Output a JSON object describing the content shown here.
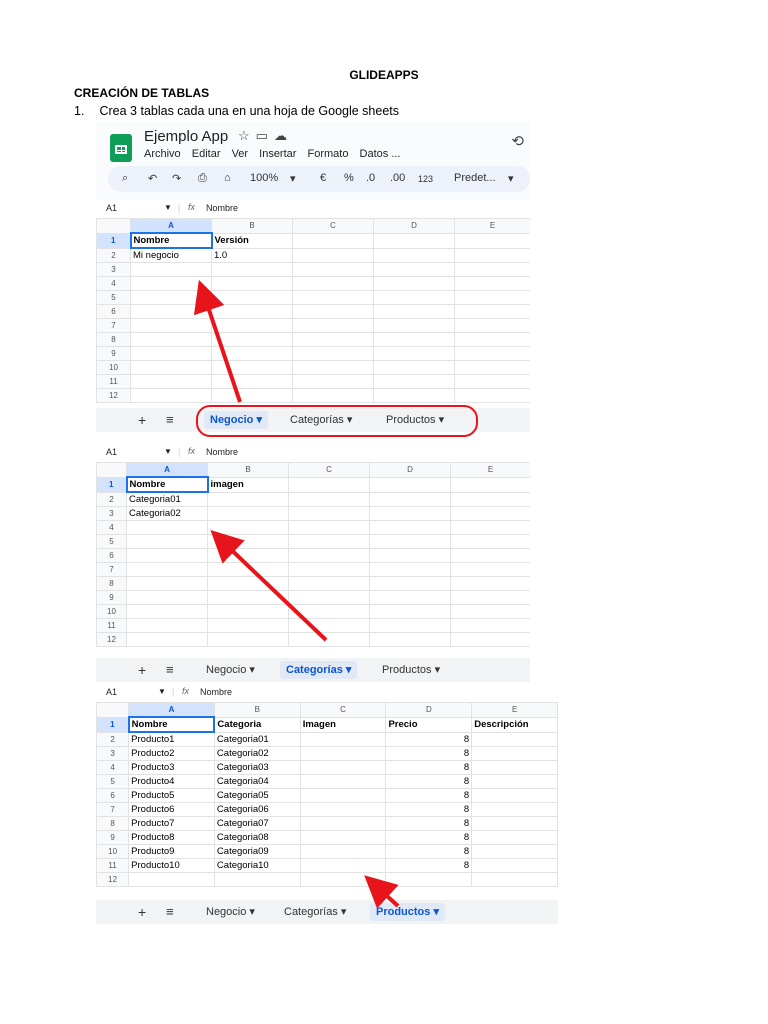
{
  "document": {
    "title": "GLIDEAPPS",
    "section": "CREACIÓN DE TABLAS",
    "step_number": "1.",
    "step_text": "Crea 3 tablas cada una en una hoja de Google sheets"
  },
  "app": {
    "title": "Ejemplo App",
    "menus": [
      "Archivo",
      "Editar",
      "Ver",
      "Insertar",
      "Formato",
      "Datos ..."
    ],
    "zoom": "100%",
    "toolbar_format": [
      "€",
      "%",
      ".0",
      ".00",
      "123"
    ],
    "font": "Predet...",
    "icons": [
      "search-icon",
      "undo-icon",
      "redo-icon",
      "print-icon",
      "paint-format-icon",
      "star-icon",
      "folder-icon",
      "cloud-icon",
      "history-icon"
    ]
  },
  "sheets": [
    {
      "cell_ref": "A1",
      "formula_value": "Nombre",
      "columns": [
        "A",
        "B",
        "C",
        "D",
        "E"
      ],
      "rows": [
        [
          "1",
          "Nombre",
          "Versión",
          "",
          "",
          ""
        ],
        [
          "2",
          "Mi negocio",
          "1.0",
          "",
          "",
          ""
        ],
        [
          "3",
          "",
          "",
          "",
          "",
          ""
        ],
        [
          "4",
          "",
          "",
          "",
          "",
          ""
        ],
        [
          "5",
          "",
          "",
          "",
          "",
          ""
        ],
        [
          "6",
          "",
          "",
          "",
          "",
          ""
        ],
        [
          "7",
          "",
          "",
          "",
          "",
          ""
        ],
        [
          "8",
          "",
          "",
          "",
          "",
          ""
        ],
        [
          "9",
          "",
          "",
          "",
          "",
          ""
        ],
        [
          "10",
          "",
          "",
          "",
          "",
          ""
        ],
        [
          "11",
          "",
          "",
          "",
          "",
          ""
        ],
        [
          "12",
          "",
          "",
          "",
          "",
          ""
        ]
      ],
      "tabs": [
        "Negocio ▾",
        "Categorías ▾",
        "Productos ▾"
      ],
      "active_tab": 0
    },
    {
      "cell_ref": "A1",
      "formula_value": "Nombre",
      "columns": [
        "A",
        "B",
        "C",
        "D",
        "E"
      ],
      "rows": [
        [
          "1",
          "Nombre",
          "imagen",
          "",
          "",
          ""
        ],
        [
          "2",
          "Categoria01",
          "",
          "",
          "",
          ""
        ],
        [
          "3",
          "Categoria02",
          "",
          "",
          "",
          ""
        ],
        [
          "4",
          "",
          "",
          "",
          "",
          ""
        ],
        [
          "5",
          "",
          "",
          "",
          "",
          ""
        ],
        [
          "6",
          "",
          "",
          "",
          "",
          ""
        ],
        [
          "7",
          "",
          "",
          "",
          "",
          ""
        ],
        [
          "8",
          "",
          "",
          "",
          "",
          ""
        ],
        [
          "9",
          "",
          "",
          "",
          "",
          ""
        ],
        [
          "10",
          "",
          "",
          "",
          "",
          ""
        ],
        [
          "11",
          "",
          "",
          "",
          "",
          ""
        ],
        [
          "12",
          "",
          "",
          "",
          "",
          ""
        ]
      ],
      "tabs": [
        "Negocio ▾",
        "Categorías ▾",
        "Productos ▾"
      ],
      "active_tab": 1
    },
    {
      "cell_ref": "A1",
      "formula_value": "Nombre",
      "columns": [
        "A",
        "B",
        "C",
        "D",
        "E"
      ],
      "rows": [
        [
          "1",
          "Nombre",
          "Categoria",
          "Imagen",
          "Precio",
          "Descripción"
        ],
        [
          "2",
          "Producto1",
          "Categoria01",
          "",
          "8",
          ""
        ],
        [
          "3",
          "Producto2",
          "Categoria02",
          "",
          "8",
          ""
        ],
        [
          "4",
          "Producto3",
          "Categoria03",
          "",
          "8",
          ""
        ],
        [
          "5",
          "Producto4",
          "Categoria04",
          "",
          "8",
          ""
        ],
        [
          "6",
          "Producto5",
          "Categoria05",
          "",
          "8",
          ""
        ],
        [
          "7",
          "Producto6",
          "Categoria06",
          "",
          "8",
          ""
        ],
        [
          "8",
          "Producto7",
          "Categoria07",
          "",
          "8",
          ""
        ],
        [
          "9",
          "Producto8",
          "Categoria08",
          "",
          "8",
          ""
        ],
        [
          "10",
          "Producto9",
          "Categoria09",
          "",
          "8",
          ""
        ],
        [
          "11",
          "Producto10",
          "Categoria10",
          "",
          "8",
          ""
        ],
        [
          "12",
          "",
          "",
          "",
          "",
          ""
        ]
      ],
      "tabs": [
        "Negocio ▾",
        "Categorías ▾",
        "Productos ▾"
      ],
      "active_tab": 2
    }
  ],
  "colors": {
    "accent": "#0b57d0",
    "annotation": "#e8141b",
    "sheets_green": "#0f9d58"
  }
}
